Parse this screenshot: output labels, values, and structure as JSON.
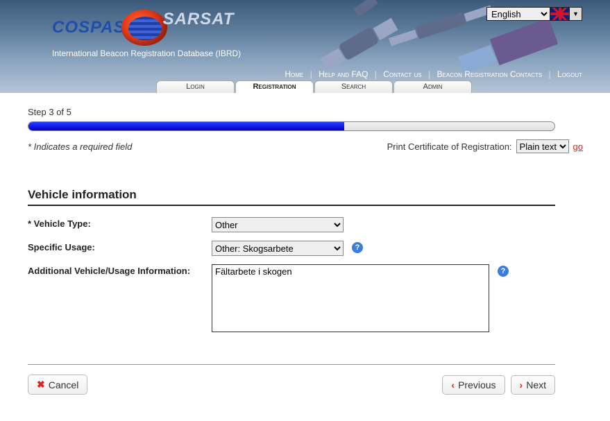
{
  "header": {
    "brand_left": "COSPAS",
    "brand_right": "SARSAT",
    "subtitle": "International Beacon Registration Database (IBRD)",
    "language_value": "English"
  },
  "nav": {
    "home": "Home",
    "help": "Help and FAQ",
    "contact": "Contact us",
    "brc": "Beacon Registration Contacts",
    "logout": "Logout"
  },
  "tabs": {
    "login": "Login",
    "registration": "Registration",
    "search": "Search",
    "admin": "Admin"
  },
  "progress": {
    "step_label": "Step 3 of 5",
    "percent": 60
  },
  "required_note": "* Indicates a required field",
  "print": {
    "label": "Print Certificate of Registration:",
    "format_value": "Plain text",
    "go_label": "go"
  },
  "section_title": "Vehicle information",
  "fields": {
    "vehicle_type": {
      "label": "Vehicle Type:",
      "value": "Other",
      "required_mark": "* "
    },
    "specific_usage": {
      "label": "Specific Usage:",
      "value": "Other: Skogsarbete"
    },
    "additional_info": {
      "label": "Additional Vehicle/Usage Information:",
      "value": "Fältarbete i skogen"
    }
  },
  "buttons": {
    "cancel": "Cancel",
    "previous": "Previous",
    "next": "Next"
  },
  "glyphs": {
    "help": "?",
    "x": "✖",
    "chev_l": "‹",
    "chev_r": "›",
    "tri_down": "▼"
  }
}
